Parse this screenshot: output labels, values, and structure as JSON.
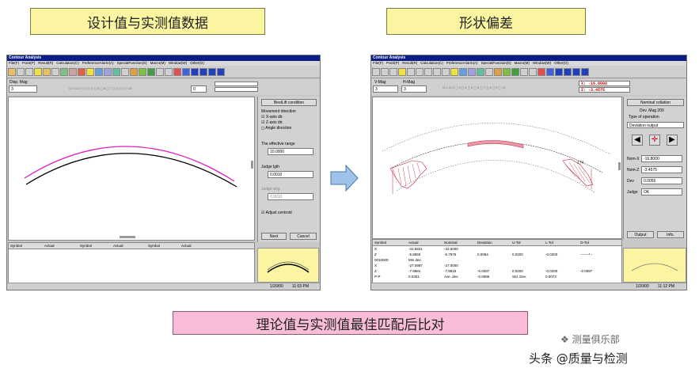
{
  "banners": {
    "top_left": "设计值与实测值数据",
    "top_right": "形状偏差",
    "bottom": "理论值与实测值最佳匹配后比对"
  },
  "watermark": {
    "line1": "测量俱乐部",
    "line2": "头条 @质量与检测"
  },
  "left_window": {
    "title": "Contour Analysis",
    "menu": [
      "File(F)",
      "Point(P)",
      "Result(R)",
      "Calculation(C)",
      "PreferenceAlarm(A)",
      "SpecialFunction(S)",
      "Macro(M)",
      "Window(W)",
      "Other(O)"
    ],
    "disp_mag_label": "Disp. Mag",
    "disp_mag_value": "3",
    "value_box": "0",
    "side": {
      "title": "BestLift condition",
      "movement_label": "Movement direction",
      "xaxis": "X-axis dir.",
      "zaxis": "Z-axis dir.",
      "angle": "Angle direction",
      "range_label": "The effective range",
      "range_value": "10.0000",
      "judge_lgth_label": "Judge lgth",
      "judge_lgth_value": "0.0010",
      "judge_ang_label": "Judge ang.",
      "judge_ang_value": "0.0010",
      "adjust_centroid": "Adjust centroid",
      "next": "Next",
      "cancel": "Cancel"
    },
    "table_headers": [
      "Symbol",
      "Actual",
      "Symbol",
      "Actual",
      "Symbol",
      "Actual"
    ],
    "status_date": "1/20/00",
    "status_time": "11:03 PM"
  },
  "right_window": {
    "title": "Contour Analysis",
    "menu": [
      "File(F)",
      "Point(P)",
      "Result(R)",
      "Calculation(C)",
      "PreferenceAlarm(A)",
      "SpecialFunction(S)",
      "Macro(M)",
      "Window(W)",
      "Other(O)"
    ],
    "vmag_label": "V-Mag",
    "hmag_label": "H-Mag",
    "vmag_value": "3",
    "hmag_value": "3",
    "coord_x": "X:    -16.8000",
    "coord_z": "Z:     -3.4575",
    "plot_label": "174",
    "side": {
      "title": "Nominal collation",
      "dev_mag": "Dev. Mag   200",
      "type_label": "Type of operation",
      "type_value": "Deviation output",
      "nom_x_label": "Nom-X",
      "nom_x_value": "-16.8000",
      "nom_z_label": "Nom-Z",
      "nom_z_value": "-3.4575",
      "dev_label": "Dev",
      "dev_value": "0.0055",
      "judge_label": "Judge",
      "judge_value": "OK",
      "output": "Output",
      "info": "Info."
    },
    "table_headers": [
      "Symbol",
      "Actual",
      "Nominal",
      "Deviation",
      "U-Tol",
      "L-Tol",
      "O-Tol"
    ],
    "table_rows": [
      [
        "X",
        "-22.5831",
        "-22.5000",
        "",
        "",
        "",
        ""
      ],
      [
        "Z",
        "-5.8550",
        "-5.7876",
        "0.0084",
        "0.0200",
        "-0.0200",
        "-------*--"
      ],
      [
        "0010000",
        "Min dev",
        "",
        "",
        "",
        "",
        ""
      ],
      [
        "X",
        "-27.0987",
        "-27.0000",
        "",
        "",
        "",
        ""
      ],
      [
        "Z",
        "-7.9981",
        "-7.9815",
        "-0.0287",
        "0.0200",
        "-0.0200",
        "-0.0087"
      ],
      [
        "P-P",
        "0.0351",
        "Ave. dev.",
        "-0.0085",
        "Std. Dev.",
        "0.0073",
        ""
      ]
    ],
    "status_date": "1/20/00",
    "status_time": "11:12 PM"
  },
  "colors": {
    "banner_yellow": "#fbf5a2",
    "banner_pink": "#f9bcd9",
    "titlebar": "#0a1c86",
    "arrow": "#9fc3e8",
    "curve_design": "#e020c0",
    "curve_measured": "#000000",
    "deviation": "#c0203a"
  }
}
